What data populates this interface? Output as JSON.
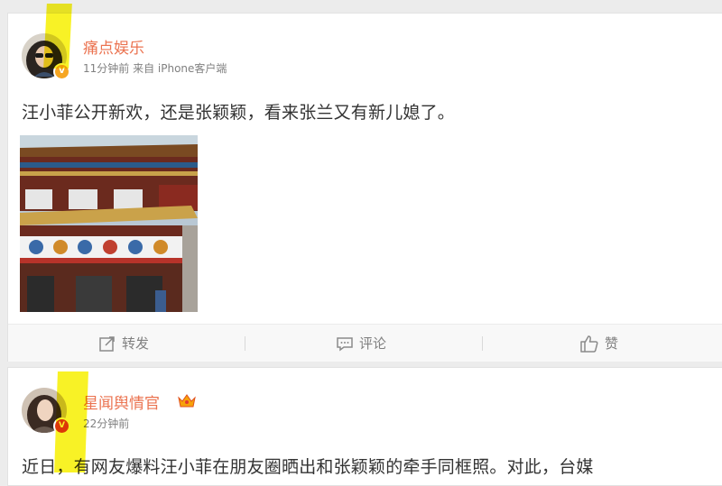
{
  "posts": [
    {
      "author": "痛点娱乐",
      "meta": "11分钟前 来自 iPhone客户端",
      "verified_badge": "V",
      "text": "汪小菲公开新欢，还是张颖颖，看来张兰又有新儿媳了。",
      "actions": {
        "repost": "转发",
        "comment": "评论",
        "like": "赞"
      }
    },
    {
      "author": "星闻舆情官",
      "meta": "22分钟前",
      "verified_badge": "V",
      "text": "近日，有网友爆料汪小菲在朋友圈晒出和张颖颖的牵手同框照。对此，台媒"
    }
  ],
  "colors": {
    "author": "#eb7350",
    "highlight": "#f7f000",
    "badge": "#f6a623"
  },
  "icons": [
    "repost-icon",
    "comment-icon",
    "like-icon",
    "verified-icon",
    "crown-icon"
  ]
}
